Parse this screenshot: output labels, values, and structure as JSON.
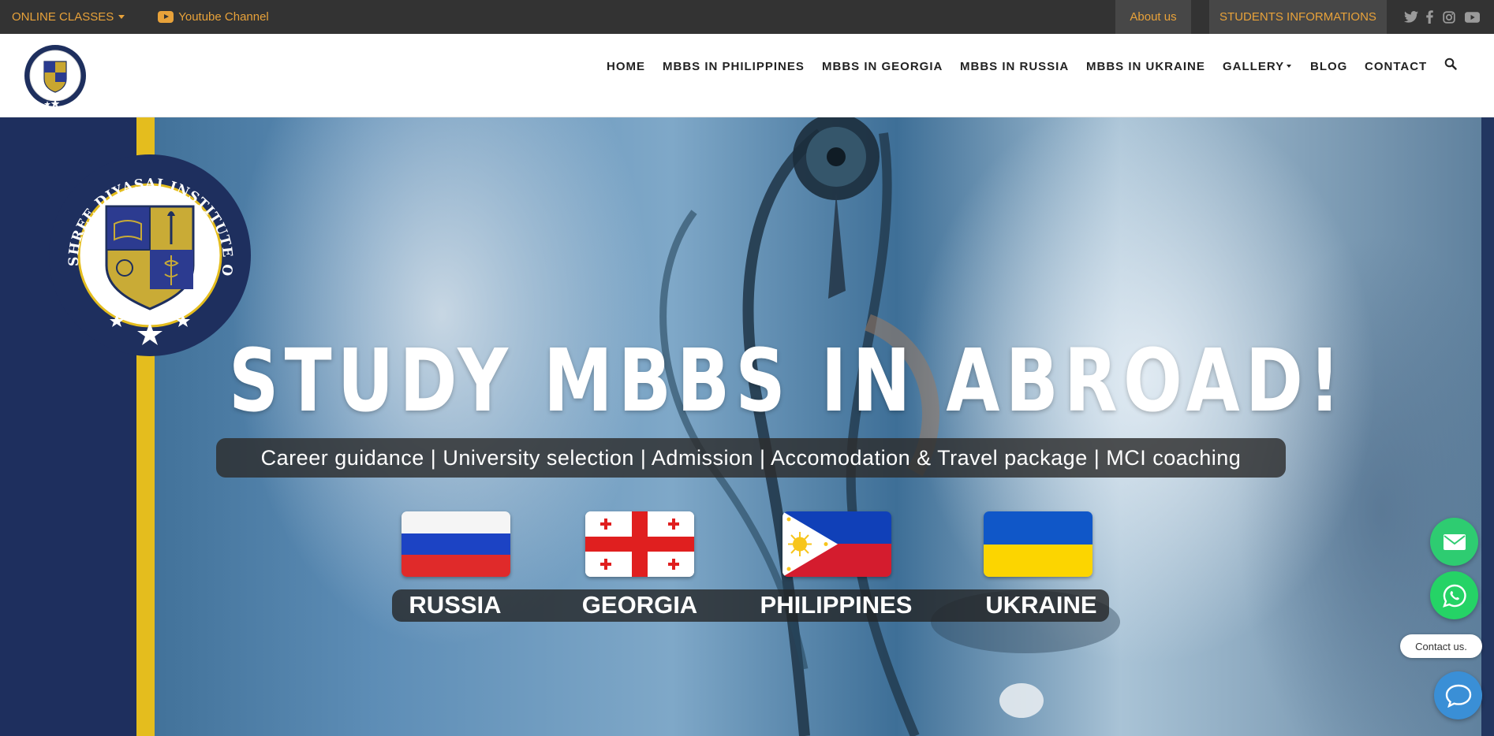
{
  "topbar": {
    "online_classes": "ONLINE CLASSES",
    "youtube": "Youtube Channel",
    "about": "About us",
    "students": "STUDENTS INFORMATIONS",
    "social_icons": [
      "twitter-icon",
      "facebook-icon",
      "instagram-icon",
      "youtube-icon"
    ]
  },
  "nav": {
    "items": [
      "HOME",
      "MBBS IN PHILIPPINES",
      "MBBS IN GEORGIA",
      "MBBS IN RUSSIA",
      "MBBS IN UKRAINE",
      "GALLERY",
      "BLOG",
      "CONTACT"
    ]
  },
  "hero": {
    "logo_text": "SHREE DIYASAI INSTITUTE OF MEDICAL SCIENCES P.LTD",
    "title": "STUDY MBBS IN ABROAD!",
    "tagline": "Career guidance | University selection | Admission | Accomodation & Travel package | MCI coaching",
    "countries": [
      "RUSSIA",
      "GEORGIA",
      "PHILIPPINES",
      "UKRAINE"
    ]
  },
  "contact_widget": {
    "label": "Contact us.",
    "email_color": "#2ecc71",
    "whatsapp_color": "#25d366",
    "chat_color": "#3a8fd6"
  },
  "colors": {
    "accent": "#e8a23a",
    "topbar_bg": "#333333",
    "navy": "#1e2f5e",
    "gold": "#e4bd1e"
  }
}
